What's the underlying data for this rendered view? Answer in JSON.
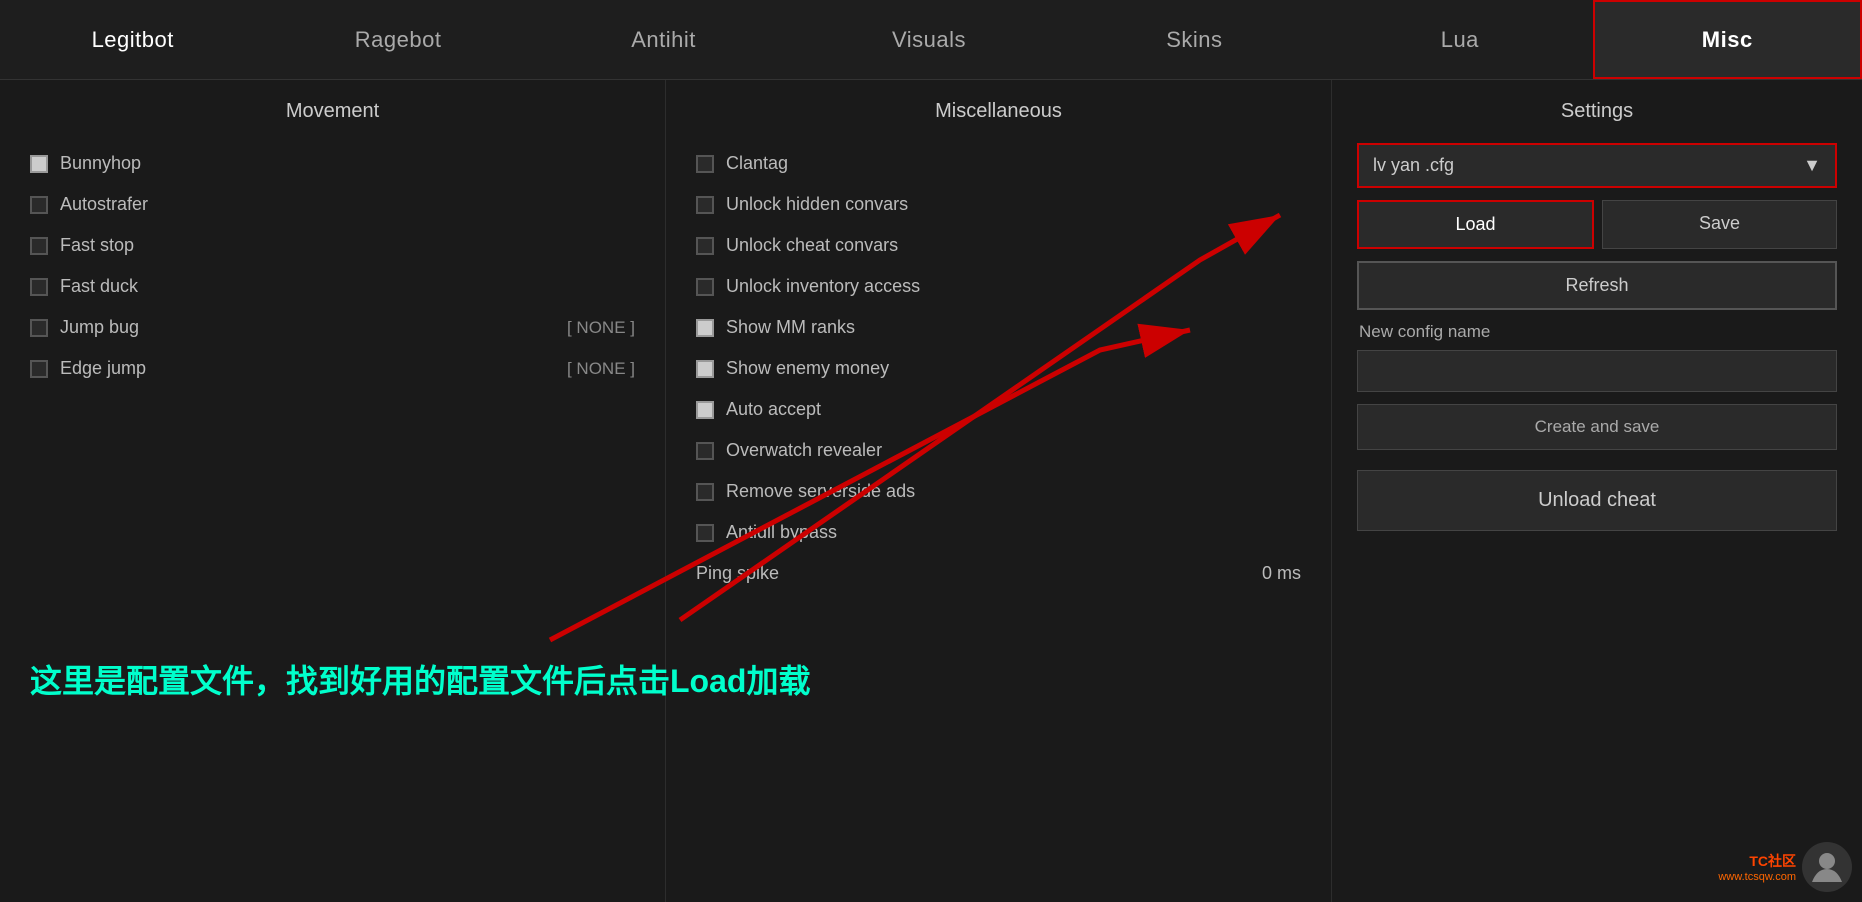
{
  "nav": {
    "items": [
      {
        "label": "Legitbot",
        "active": false
      },
      {
        "label": "Ragebot",
        "active": false
      },
      {
        "label": "Antihit",
        "active": false
      },
      {
        "label": "Visuals",
        "active": false
      },
      {
        "label": "Skins",
        "active": false
      },
      {
        "label": "Lua",
        "active": false
      },
      {
        "label": "Misc",
        "active": true
      }
    ]
  },
  "movement": {
    "title": "Movement",
    "options": [
      {
        "label": "Bunnyhop",
        "checked": true,
        "whiteCheck": true,
        "keybind": ""
      },
      {
        "label": "Autostrafer",
        "checked": false,
        "whiteCheck": false,
        "keybind": ""
      },
      {
        "label": "Fast stop",
        "checked": false,
        "whiteCheck": false,
        "keybind": ""
      },
      {
        "label": "Fast duck",
        "checked": false,
        "whiteCheck": false,
        "keybind": ""
      },
      {
        "label": "Jump bug",
        "checked": false,
        "whiteCheck": false,
        "keybind": "[ NONE ]"
      },
      {
        "label": "Edge jump",
        "checked": false,
        "whiteCheck": false,
        "keybind": "[ NONE ]"
      }
    ]
  },
  "misc": {
    "title": "Miscellaneous",
    "options": [
      {
        "label": "Clantag",
        "checked": false,
        "whiteCheck": false
      },
      {
        "label": "Unlock hidden convars",
        "checked": false,
        "whiteCheck": false
      },
      {
        "label": "Unlock cheat convars",
        "checked": false,
        "whiteCheck": false
      },
      {
        "label": "Unlock inventory access",
        "checked": false,
        "whiteCheck": false
      },
      {
        "label": "Show MM ranks",
        "checked": true,
        "whiteCheck": true
      },
      {
        "label": "Show enemy money",
        "checked": true,
        "whiteCheck": true
      },
      {
        "label": "Auto accept",
        "checked": true,
        "whiteCheck": true
      },
      {
        "label": "Overwatch revealer",
        "checked": false,
        "whiteCheck": false
      },
      {
        "label": "Remove serverside ads",
        "checked": false,
        "whiteCheck": false
      },
      {
        "label": "Antidll bypass",
        "checked": false,
        "whiteCheck": false
      }
    ],
    "ping_spike_label": "Ping spike",
    "ping_spike_value": "0 ms"
  },
  "settings": {
    "title": "Settings",
    "config_value": "lv yan .cfg",
    "load_label": "Load",
    "save_label": "Save",
    "refresh_label": "Refresh",
    "new_config_label": "New config name",
    "create_label": "Create and save",
    "unload_label": "Unload cheat"
  },
  "overlay": {
    "text": "这里是配置文件，找到好用的配置文件后点击Load加载"
  },
  "watermark": {
    "tc_label": "TC社区",
    "url_label": "www.tcsqw.com"
  }
}
